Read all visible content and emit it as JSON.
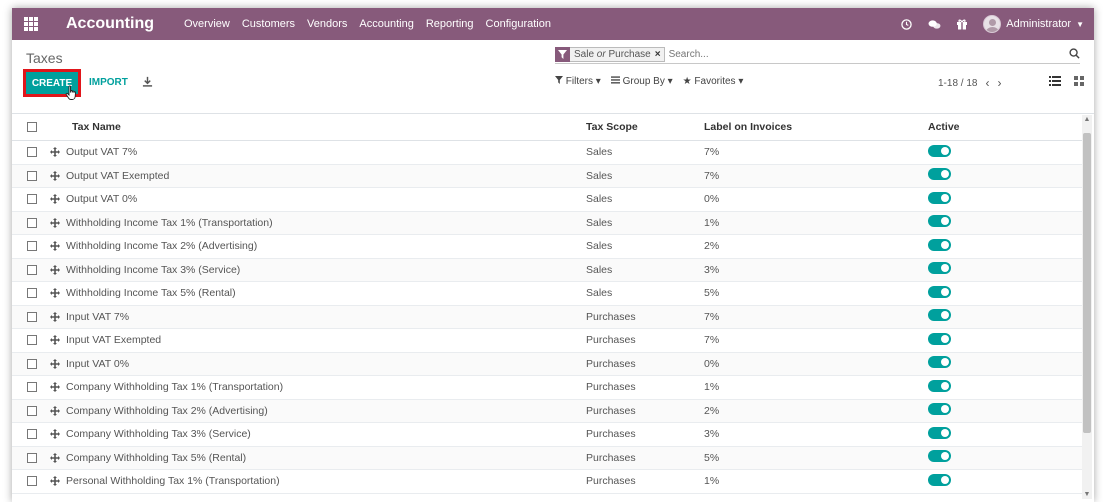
{
  "navbar": {
    "app_title": "Accounting",
    "menu": [
      "Overview",
      "Customers",
      "Vendors",
      "Accounting",
      "Reporting",
      "Configuration"
    ],
    "user": "Administrator",
    "bg_color": "#875a7b"
  },
  "control_panel": {
    "breadcrumb": "Taxes",
    "facet": {
      "part1": "Sale",
      "connector": "or",
      "part2": "Purchase",
      "remove": "×"
    },
    "search_placeholder": "Search...",
    "create_label": "CREATE",
    "import_label": "IMPORT",
    "filters_label": "Filters",
    "group_by_label": "Group By",
    "favorites_label": "Favorites",
    "pager": "1-18 / 18",
    "accent_color": "#00a09d"
  },
  "table": {
    "headers": {
      "name": "Tax Name",
      "scope": "Tax Scope",
      "label": "Label on Invoices",
      "active": "Active"
    },
    "rows": [
      {
        "name": "Output VAT 7%",
        "scope": "Sales",
        "label": "7%",
        "active": true
      },
      {
        "name": "Output VAT Exempted",
        "scope": "Sales",
        "label": "7%",
        "active": true
      },
      {
        "name": "Output VAT 0%",
        "scope": "Sales",
        "label": "0%",
        "active": true
      },
      {
        "name": "Withholding Income Tax 1% (Transportation)",
        "scope": "Sales",
        "label": "1%",
        "active": true
      },
      {
        "name": "Withholding Income Tax 2% (Advertising)",
        "scope": "Sales",
        "label": "2%",
        "active": true
      },
      {
        "name": "Withholding Income Tax 3% (Service)",
        "scope": "Sales",
        "label": "3%",
        "active": true
      },
      {
        "name": "Withholding Income Tax 5% (Rental)",
        "scope": "Sales",
        "label": "5%",
        "active": true
      },
      {
        "name": "Input VAT 7%",
        "scope": "Purchases",
        "label": "7%",
        "active": true
      },
      {
        "name": "Input VAT Exempted",
        "scope": "Purchases",
        "label": "7%",
        "active": true
      },
      {
        "name": "Input VAT 0%",
        "scope": "Purchases",
        "label": "0%",
        "active": true
      },
      {
        "name": "Company Withholding Tax 1% (Transportation)",
        "scope": "Purchases",
        "label": "1%",
        "active": true
      },
      {
        "name": "Company Withholding Tax 2% (Advertising)",
        "scope": "Purchases",
        "label": "2%",
        "active": true
      },
      {
        "name": "Company Withholding Tax 3% (Service)",
        "scope": "Purchases",
        "label": "3%",
        "active": true
      },
      {
        "name": "Company Withholding Tax 5% (Rental)",
        "scope": "Purchases",
        "label": "5%",
        "active": true
      },
      {
        "name": "Personal Withholding Tax 1% (Transportation)",
        "scope": "Purchases",
        "label": "1%",
        "active": true
      }
    ]
  }
}
